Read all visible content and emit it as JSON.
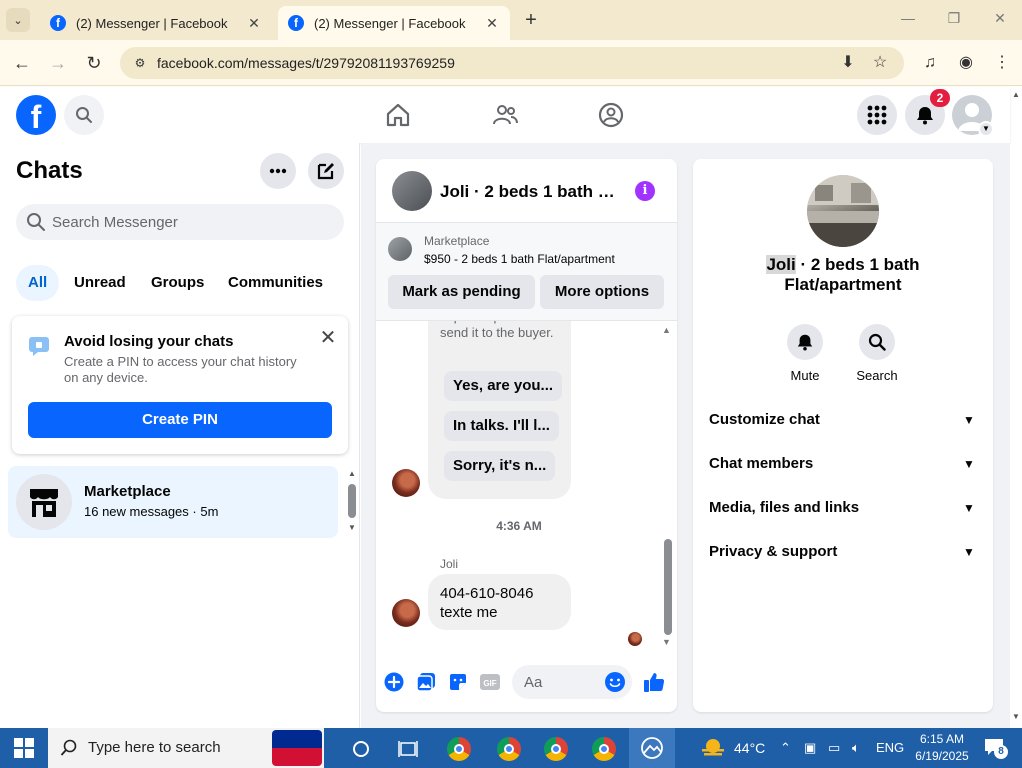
{
  "browser": {
    "tabs": [
      {
        "title": "(2) Messenger | Facebook",
        "active": false
      },
      {
        "title": "(2) Messenger | Facebook",
        "active": true
      }
    ],
    "url": "facebook.com/messages/t/29792081193769259"
  },
  "fb_header": {
    "notification_count": "2"
  },
  "left_panel": {
    "title": "Chats",
    "search_placeholder": "Search Messenger",
    "filters": [
      "All",
      "Unread",
      "Groups",
      "Communities"
    ],
    "pin_card": {
      "title": "Avoid losing your chats",
      "description": "Create a PIN to access your chat history on any device.",
      "button": "Create PIN"
    },
    "conversations": [
      {
        "name": "Marketplace",
        "subtitle": "16 new messages · 5m"
      }
    ]
  },
  "chat": {
    "header_title": "Joli · 2 beds 1 bath Fl...",
    "marketplace": {
      "label": "Marketplace",
      "listing": "$950 - 2 beds 1 bath Flat/apartment",
      "pending_button": "Mark as pending",
      "more_button": "More options"
    },
    "quick_hint": "Tap a response to send it to the buyer.",
    "quick_replies": [
      "Yes, are you...",
      "In talks. I'll l...",
      "Sorry, it's n..."
    ],
    "timestamp": "4:36 AM",
    "sender": "Joli",
    "message_lines": [
      "404-610-8046",
      "texte me"
    ],
    "composer_placeholder": "Aa"
  },
  "info": {
    "name_first": "Joli",
    "name_rest": " · 2 beds 1 bath Flat/apartment",
    "actions": [
      {
        "label": "Mute",
        "icon": "bell-icon"
      },
      {
        "label": "Search",
        "icon": "search-icon"
      }
    ],
    "sections": [
      "Customize chat",
      "Chat members",
      "Media, files and links",
      "Privacy & support"
    ]
  },
  "taskbar": {
    "search_placeholder": "Type here to search",
    "temperature": "44°C",
    "language": "ENG",
    "time": "6:15 AM",
    "date": "6/19/2025",
    "notification_count": "8"
  },
  "colors": {
    "fb_blue": "#0866ff",
    "info_purple": "#a033ff",
    "badge_red": "#e41e3f",
    "taskbar": "#1f5fa8"
  }
}
